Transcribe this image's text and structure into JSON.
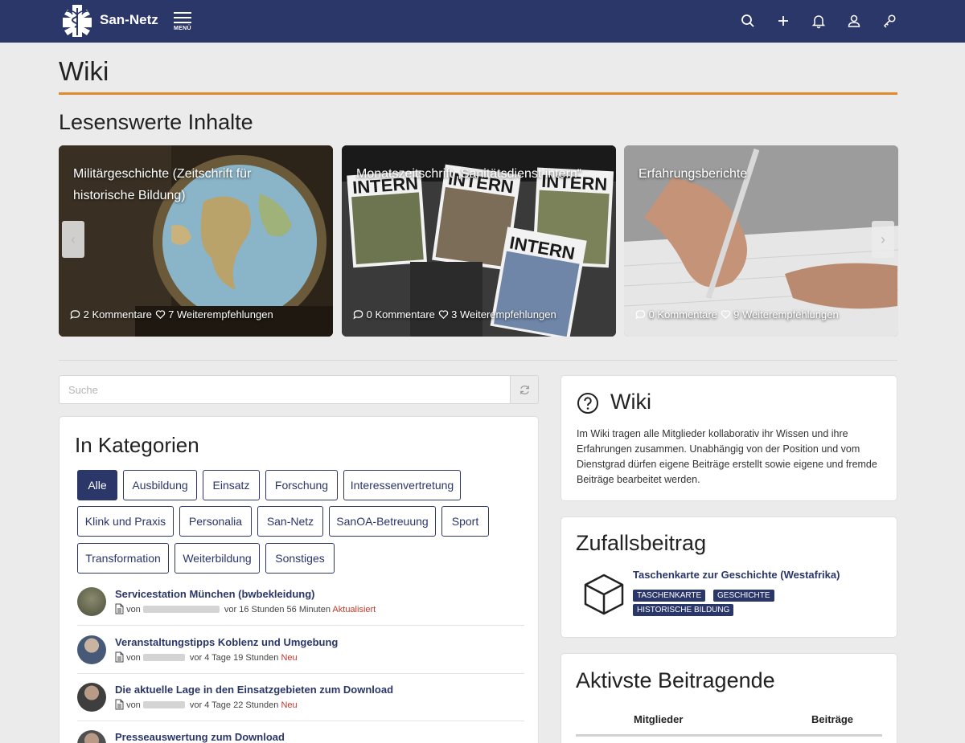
{
  "app": {
    "brand": "San-Netz",
    "menu_label": "MENÜ"
  },
  "nav_icons": [
    "search-icon",
    "plus-icon",
    "bell-icon",
    "user-icon",
    "key-icon"
  ],
  "page": {
    "title": "Wiki"
  },
  "featured": {
    "title": "Lesenswerte Inhalte",
    "cards": [
      {
        "title": "Militärgeschichte (Zeitschrift für historische Bildung)",
        "comments": "2 Kommentare",
        "recommendations": "7 Weiterempfehlungen"
      },
      {
        "title": "Monatszeitschrift „Sanitätsdienst intern“",
        "comments": "0 Kommentare",
        "recommendations": "3 Weiterempfehlungen"
      },
      {
        "title": "Erfahrungsberichte",
        "comments": "0 Kommentare",
        "recommendations": "9 Weiterempfehlungen"
      }
    ],
    "prev_arrow": "‹",
    "next_arrow": "›",
    "magazine_word": "INTERN"
  },
  "search": {
    "placeholder": "Suche"
  },
  "categories": {
    "title": "In Kategorien",
    "tags": [
      "Alle",
      "Ausbildung",
      "Einsatz",
      "Forschung",
      "Interessenvertretung",
      "Klink und Praxis",
      "Personalia",
      "San-Netz",
      "SanOA-Betreuung",
      "Sport",
      "Transformation",
      "Weiterbildung",
      "Sonstiges"
    ],
    "active_tag": "Alle"
  },
  "entries": [
    {
      "title": "Servicestation München (bwbekleidung)",
      "by": "von",
      "time": "vor 16 Stunden 56 Minuten",
      "status": "Aktualisiert"
    },
    {
      "title": "Veranstaltungstipps Koblenz und Umgebung",
      "by": "von",
      "time": "vor 4 Tage 19 Stunden",
      "status": "Neu"
    },
    {
      "title": "Die aktuelle Lage in den Einsatzgebieten zum Download",
      "by": "von",
      "time": "vor 4 Tage 22 Stunden",
      "status": "Neu"
    },
    {
      "title": "Presseauswertung zum Download",
      "by": "",
      "time": "",
      "status": ""
    }
  ],
  "wiki_info": {
    "title": "Wiki",
    "text": "Im Wiki tragen alle Mitglieder kollaborativ ihr Wissen und ihre Erfahrungen zusammen. Unabhängig von der Position und vom Dienstgrad dürfen eigene Beiträge erstellt sowie eigene und fremde Beiträge bearbeitet werden."
  },
  "random_post": {
    "title": "Zufallsbeitrag",
    "link": "Taschenkarte zur Geschichte (Westafrika)",
    "labels": [
      "TASCHENKARTE",
      "GESCHICHTE",
      "HISTORISCHE BILDUNG"
    ]
  },
  "most_active": {
    "title": "Aktivste Beitragende",
    "col_members": "Mitglieder",
    "col_posts": "Beiträge"
  },
  "colors": {
    "navbar": "#2b3669",
    "accent_rule": "#e2892b",
    "status": "#c0392b",
    "background": "#ebebeb"
  }
}
